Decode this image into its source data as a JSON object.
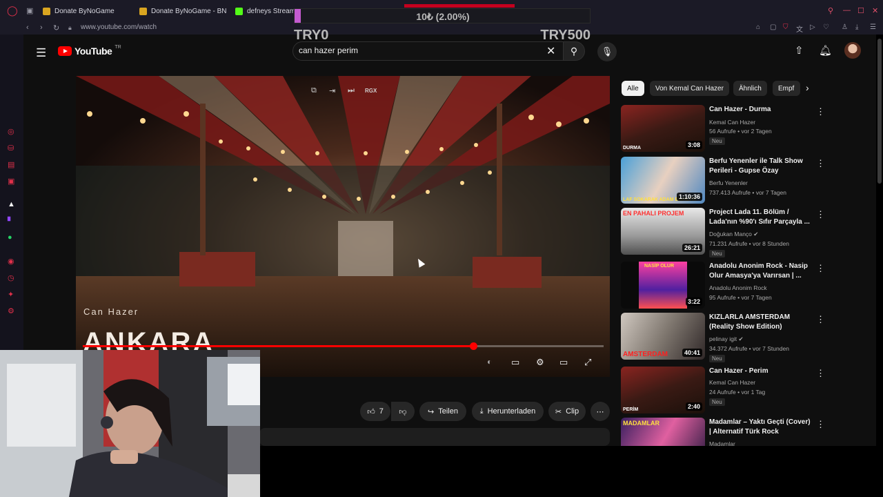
{
  "browser": {
    "tabs": [
      {
        "label": "Donate ByNoGame"
      },
      {
        "label": "Donate ByNoGame - BN"
      },
      {
        "label": "defneys Stream"
      }
    ],
    "url": "www.youtube.com/watch"
  },
  "youtube": {
    "logo_text": "YouTube",
    "logo_sup": "TR",
    "search": {
      "value": "can hazer perim"
    }
  },
  "donation_overlay": {
    "percent_text": "10₺ (2.00%)",
    "progress": 0.02,
    "min_label": "TRY0",
    "max_label": "TRY500"
  },
  "player": {
    "artist_overlay": "Can Hazer",
    "title_overlay": "ANKARA",
    "progress": 0.75,
    "rgx_label": "RGX"
  },
  "actions": {
    "like_count": "7",
    "share_label": "Teilen",
    "download_label": "Herunterladen",
    "clip_label": "Clip"
  },
  "chips": [
    "Alle",
    "Von Kemal Can Hazer",
    "Ähnlich",
    "Empf"
  ],
  "recommendations": [
    {
      "title": "Can Hazer - Durma",
      "channel": "Kemal Can Hazer",
      "meta": "56 Aufrufe • vor 2 Tagen",
      "badge": "Neu",
      "duration": "3:08",
      "caption": "DURMA",
      "verified": false
    },
    {
      "title": "Berfu Yenenler ile Talk Show Perileri - Gupse Özay",
      "channel": "Berfu Yenenler",
      "meta": "737.413 Aufrufe • vor 7 Tagen",
      "badge": "",
      "duration": "1:10:36",
      "caption": "LAF SOKARAK ADAM BAYILTTI",
      "verified": false
    },
    {
      "title": "Project Lada 11. Bölüm / Lada'nın %90'ı Sıfır Parçayla ...",
      "channel": "Doğukan Manço",
      "meta": "71.231 Aufrufe • vor 8 Stunden",
      "badge": "Neu",
      "duration": "26:21",
      "caption": "EN PAHALI PROJEM",
      "verified": true
    },
    {
      "title": "Anadolu Anonim Rock - Nasip Olur Amasya'ya Varırsan | ...",
      "channel": "Anadolu Anonim Rock",
      "meta": "95 Aufrufe • vor 7 Tagen",
      "badge": "",
      "duration": "3:22",
      "caption": "NASİP OLUR",
      "verified": false
    },
    {
      "title": "KIZLARLA AMSTERDAM (Reality Show Edition)",
      "channel": "pelinay igit",
      "meta": "34.372 Aufrufe • vor 7 Stunden",
      "badge": "Neu",
      "duration": "40:41",
      "caption": "AMSTERDAM",
      "verified": true
    },
    {
      "title": "Can Hazer - Perim",
      "channel": "Kemal Can Hazer",
      "meta": "24 Aufrufe • vor 1 Tag",
      "badge": "Neu",
      "duration": "2:40",
      "caption": "PERİM",
      "verified": false
    },
    {
      "title": "Madamlar – Yaktı Geçti (Cover) | Alternatif Türk Rock",
      "channel": "Madamlar",
      "meta": "",
      "badge": "",
      "duration": "",
      "caption": "MADAMLAR",
      "verified": false
    }
  ],
  "colors": {
    "accent": "#ff0000",
    "donate_fill": "#c45bd0",
    "page_bg": "#0f0f0f"
  }
}
